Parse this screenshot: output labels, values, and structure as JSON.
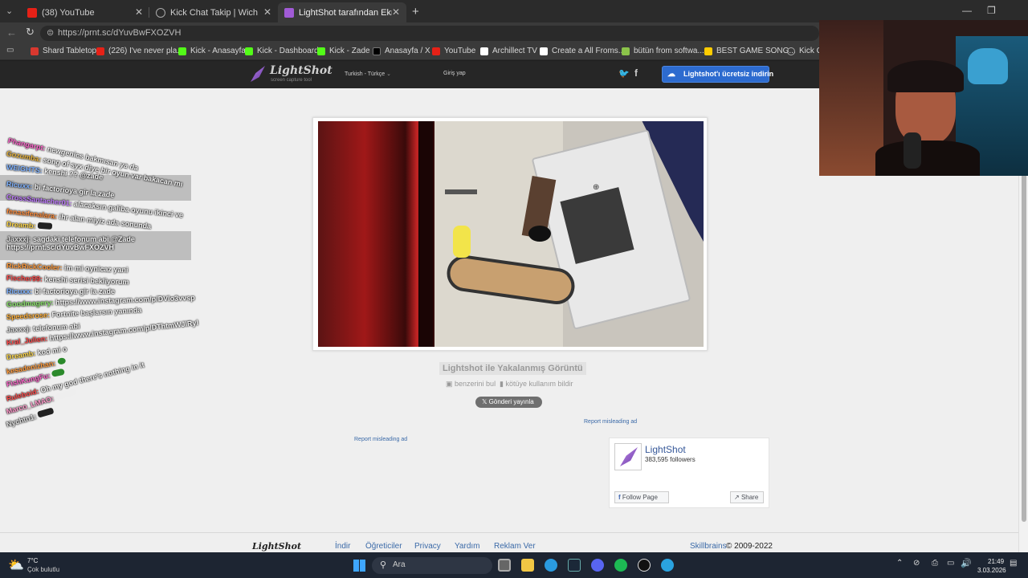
{
  "tabs": [
    {
      "label": "(38) YouTube",
      "icon": "youtube-icon",
      "color": "#e62117"
    },
    {
      "label": "Kick Chat Takip | Wich",
      "icon": "globe-icon",
      "color": "#9aa0a6"
    },
    {
      "label": "LightShot tarafından Ekran Görünt",
      "icon": "lightshot-feather-icon",
      "color": "#a15bd6"
    }
  ],
  "address": {
    "url": "https://prnt.sc/dYuvBwFXOZVH"
  },
  "bookmarks": [
    {
      "label": "Shard Tabletop",
      "color": "#d9382f"
    },
    {
      "label": "(226) I've never pla...",
      "color": "#e62117"
    },
    {
      "label": "Kick - Anasayfa",
      "color": "#53fc18"
    },
    {
      "label": "Kick - Dashboard",
      "color": "#53fc18"
    },
    {
      "label": "Kick - Zade",
      "color": "#53fc18"
    },
    {
      "label": "Anasayfa / X",
      "color": "#000000"
    },
    {
      "label": "YouTube",
      "color": "#e62117"
    },
    {
      "label": "Archillect TV",
      "color": "#ffffff"
    },
    {
      "label": "Create a All Froms...",
      "color": "#ffffff"
    },
    {
      "label": "bütün from softwa...",
      "color": "#8bc34a"
    },
    {
      "label": "BEST GAME SONG...",
      "color": "#ffcc00"
    },
    {
      "label": "Kick Ch",
      "color": "#9aa0a6"
    }
  ],
  "lightshot": {
    "logo": "LightShot",
    "tagline": "screen capture tool",
    "language": "Turkish - Türkçe",
    "login": "Giriş yap",
    "download_button": "Lightshot'ı ücretsiz indirin",
    "caption": "Lightshot ile Yakalanmış Görüntü",
    "find_similar": "benzerini bul",
    "report_abuse": "kötüye kullanım bildir",
    "tweet_button": "Gönderi yayınla",
    "ad_link_right": "Report misleading ad",
    "ad_link_left": "Report misleading ad"
  },
  "fb_widget": {
    "page_name": "LightShot",
    "followers": "383,595 followers",
    "follow_button": "Follow Page",
    "share_button": "Share"
  },
  "footer": {
    "logo": "LightShot",
    "links": [
      "İndir",
      "Öğreticiler",
      "Privacy",
      "Yardım",
      "Reklam Ver"
    ],
    "company": "Skillbrains",
    "copyright": "© 2009-2022"
  },
  "chat_overlay": [
    {
      "user": "Phangarpt:",
      "msg": "newgenics bakmısan ya da",
      "color": "#ff66cc"
    },
    {
      "user": "Gozumba:",
      "msg": "song of syx diye bir oyun var bakacan mı",
      "color": "#e8b33a"
    },
    {
      "user": "WEIGHTS:",
      "msg": "kenshi ?? @zade",
      "color": "#7fb2ff"
    },
    {
      "user": "Ricuxx:",
      "msg": "bi factorioya gir la zade",
      "color": "#7fb2ff"
    },
    {
      "user": "CrossSantacher01:",
      "msg": "alacaksın galiba oyunu ikinci ve",
      "color": "#c07bff"
    },
    {
      "user": "fenasifenalara:",
      "msg": "ihr alan miyiz ada sonunda",
      "color": "#ff8c3a"
    },
    {
      "user": "Dreamb:",
      "msg": "",
      "color": "#ffd84a"
    },
    {
      "user": "Jaxxxj:",
      "msg": "sagdaki telefonum abi @Zade https://prnt.sc/dYuvBwFXOZVH",
      "color": "#dddddd"
    },
    {
      "user": "RickRickCooler:",
      "msg": "im mi oynicaz yani",
      "color": "#ff9a3a"
    },
    {
      "user": "Fischer99:",
      "msg": "kenshi serisi bekliyorum",
      "color": "#ff4a4a"
    },
    {
      "user": "Ricuxx:",
      "msg": "bi factorioya gir la zade",
      "color": "#7fb2ff"
    },
    {
      "user": "Goodmagery:",
      "msg": "https://www.instagram.com/p/DVlo3vvsp",
      "color": "#8be36b"
    },
    {
      "user": "Speedsrose:",
      "msg": "Fortnite başlarsın yanında",
      "color": "#ffb03a"
    },
    {
      "user": "Jaxxxj:",
      "msg": "telefonum abi",
      "color": "#dddddd"
    },
    {
      "user": "Kral_Julien:",
      "msg": "https://www.instagram.com/p/DThtmWJIRyl",
      "color": "#ff4a4a"
    },
    {
      "user": "Dreamb:",
      "msg": "kod mi o",
      "color": "#ffd84a"
    },
    {
      "user": "kesadenizhan:",
      "msg": "",
      "color": "#ff9a3a"
    },
    {
      "user": "FishKungFu:",
      "msg": "",
      "color": "#ff66cc"
    },
    {
      "user": "Ruleboid:",
      "msg": "Oh my god there's nothing in it",
      "color": "#ff4a4a"
    },
    {
      "user": "Marco_LMAO:",
      "msg": "",
      "color": "#ff9acb"
    },
    {
      "user": "Nychtn1:",
      "msg": "",
      "color": "#dddddd"
    }
  ],
  "taskbar": {
    "weather_temp": "7°C",
    "weather_desc": "Çok bulutlu",
    "search_label": "Ara",
    "time": "21:49",
    "date": "3.03.2026"
  },
  "colors": {
    "accent_blue": "#2d6bcf",
    "header_dark": "#262626",
    "page_bg": "#efefef"
  }
}
